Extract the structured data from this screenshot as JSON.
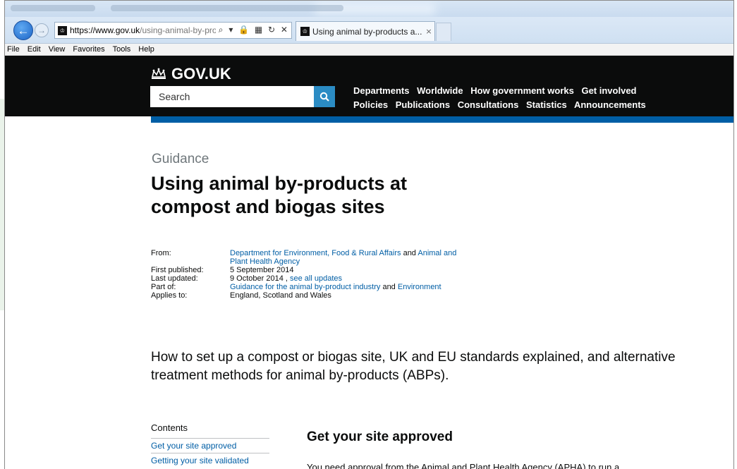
{
  "browser": {
    "url_main": "https://www.gov.uk",
    "url_rest": "/using-animal-by-produ",
    "address_icons": "⌕ ▾ 🔒 ▦ ↻ ✕",
    "tab_title": "Using animal by-products a...",
    "tab_close": "×",
    "favicon_glyph": "♔"
  },
  "menubar": {
    "items": [
      "File",
      "Edit",
      "View",
      "Favorites",
      "Tools",
      "Help"
    ]
  },
  "gov": {
    "logo_text": "GOV.UK",
    "search_placeholder": "Search",
    "nav_row1": [
      "Departments",
      "Worldwide",
      "How government works",
      "Get involved"
    ],
    "nav_row2": [
      "Policies",
      "Publications",
      "Consultations",
      "Statistics",
      "Announcements"
    ]
  },
  "page": {
    "doc_type": "Guidance",
    "title": "Using animal by-products at compost and biogas sites",
    "meta": {
      "from_label": "From:",
      "from_link1": "Department for Environment, Food & Rural Affairs",
      "from_and": " and ",
      "from_link2a": "Animal and",
      "from_link2b": "Plant Health Agency",
      "first_published_label": "First published:",
      "first_published": "5 September 2014",
      "last_updated_label": "Last updated:",
      "last_updated": "9 October 2014",
      "last_updated_sep": " , ",
      "see_all_updates": "see all updates",
      "part_of_label": "Part of:",
      "part_of_link1": "Guidance for the animal by-product industry",
      "part_of_and": " and ",
      "part_of_link2": "Environment",
      "applies_to_label": "Applies to:",
      "applies_to": "England, Scotland and Wales"
    },
    "description": "How to set up a compost or biogas site, UK and EU standards explained, and alternative treatment methods for animal by-products (ABPs).",
    "contents_title": "Contents",
    "contents": [
      "Get your site approved",
      "Getting your site validated"
    ],
    "section_heading": "Get your site approved",
    "section_body": "You need approval from the Animal and Plant Health Agency (APHA) to run a"
  },
  "colors": {
    "gov_black": "#0b0c0c",
    "link_blue": "#005ea5",
    "search_blue": "#2b8cc4",
    "secondary_text": "#6f777b"
  }
}
